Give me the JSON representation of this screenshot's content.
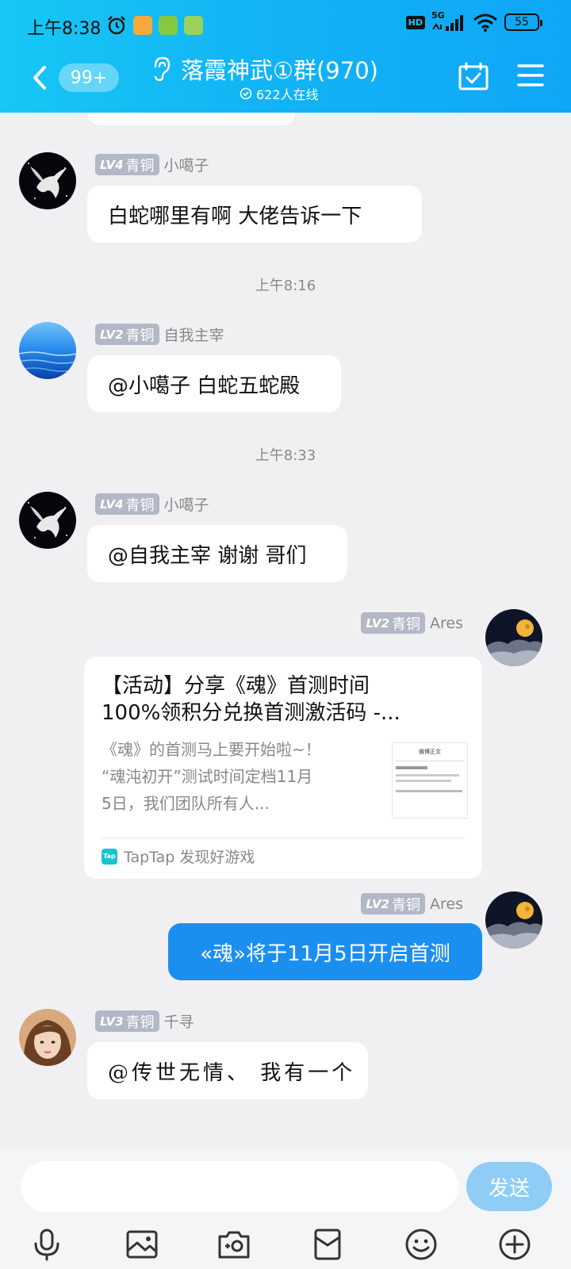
{
  "status_bar": {
    "time": "上午8:38",
    "hd": "HD",
    "network": "5G",
    "battery": "55"
  },
  "header": {
    "unread_count": "99+",
    "title": "落霞神武①群(970)",
    "online": "622人在线",
    "colors": {
      "gradient_start": "#17c7f5",
      "gradient_end": "#0fa6f6"
    }
  },
  "chat": {
    "time_separators": [
      "上午8:16",
      "上午8:33"
    ],
    "messages": [
      {
        "level": "LV4",
        "rank": "青铜",
        "sender": "小噶子",
        "text": "白蛇哪里有啊  大佬告诉一下",
        "side": "left"
      },
      {
        "level": "LV2",
        "rank": "青铜",
        "sender": "自我主宰",
        "text": "@小噶子 白蛇五蛇殿",
        "side": "left"
      },
      {
        "level": "LV4",
        "rank": "青铜",
        "sender": "小噶子",
        "text": "@自我主宰 谢谢 哥们",
        "side": "left"
      },
      {
        "level": "LV2",
        "rank": "青铜",
        "sender": "Ares",
        "side": "right",
        "card": {
          "title_line1": "【活动】分享《魂》首测时间",
          "title_line2": "100%领积分兑换首测激活码 -...",
          "desc_line1": "《魂》的首测马上要开始啦~！",
          "desc_line2": "“魂沌初开”测试时间定档11月",
          "desc_line3": "5日，我们团队所有人...",
          "thumb_header": "微博正文",
          "source": "TapTap 发现好游戏",
          "source_logo": "Tap"
        }
      },
      {
        "level": "LV2",
        "rank": "青铜",
        "sender": "Ares",
        "text": "«魂»将于11月5日开启首测",
        "side": "right"
      },
      {
        "level": "LV3",
        "rank": "青铜",
        "sender": "千寻",
        "text": "@传世无情、 我有一个",
        "side": "left"
      }
    ]
  },
  "input": {
    "value": "",
    "send_label": "发送"
  },
  "toolbar_icons": [
    "microphone-icon",
    "image-icon",
    "camera-icon",
    "red-packet-icon",
    "emoji-icon",
    "plus-icon"
  ],
  "colors": {
    "bubble_blue": "#1b8ff0",
    "send_button": "#8fcdf7",
    "level_badge": "#b3b8c7",
    "background": "#f0f0f3"
  }
}
